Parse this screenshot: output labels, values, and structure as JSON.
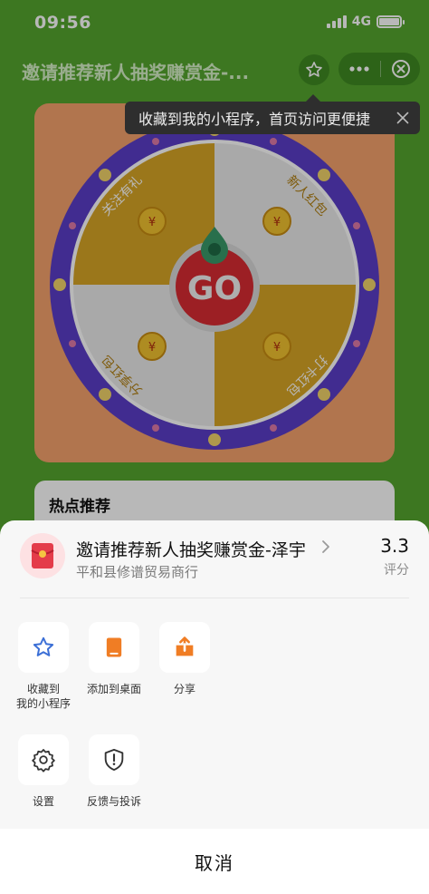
{
  "status": {
    "time": "09:56",
    "network": "4G"
  },
  "nav": {
    "title": "邀请推荐新人抽奖赚赏金-..."
  },
  "tooltip": {
    "text": "收藏到我的小程序，首页访问更便捷"
  },
  "wheel": {
    "center_label": "GO",
    "segments": [
      "关注有礼",
      "新人红包",
      "分享红包",
      "打卡红包"
    ],
    "colors": {
      "ring": "#5a3ec8",
      "gold": "#d7a526",
      "light": "#ebebeb",
      "button": "#d92b32",
      "pointer": "#3a9a6a"
    }
  },
  "hot": {
    "title": "热点推荐"
  },
  "sheet": {
    "app_name": "邀请推荐新人抽奖赚赏金-泽宇",
    "company": "平和县修谱贸易商行",
    "rating_value": "3.3",
    "rating_label": "评分",
    "actions": [
      {
        "label": "收藏到\n我的小程序",
        "icon": "star-outline-icon",
        "color": "#3b6fd6"
      },
      {
        "label": "添加到桌面",
        "icon": "add-to-desktop-icon",
        "color": "#f07d24"
      },
      {
        "label": "分享",
        "icon": "share-icon",
        "color": "#f07d24"
      },
      {
        "label": "设置",
        "icon": "gear-icon",
        "color": "#333333"
      },
      {
        "label": "反馈与投诉",
        "icon": "shield-alert-icon",
        "color": "#333333"
      }
    ],
    "cancel_label": "取消"
  }
}
